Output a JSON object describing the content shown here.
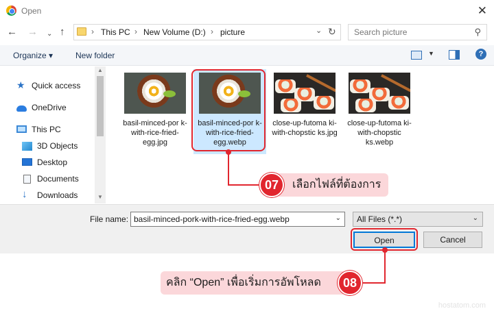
{
  "window": {
    "title": "Open"
  },
  "address": {
    "crumbs": [
      "This PC",
      "New Volume (D:)",
      "picture"
    ]
  },
  "search": {
    "placeholder": "Search picture"
  },
  "toolbar": {
    "organize": "Organize ▾",
    "new_folder": "New folder"
  },
  "sidebar": {
    "items": [
      {
        "label": "Quick access",
        "icon": "star-icon"
      },
      {
        "label": "OneDrive",
        "icon": "cloud-icon"
      },
      {
        "label": "This PC",
        "icon": "computer-icon"
      },
      {
        "label": "3D Objects",
        "icon": "cube-icon"
      },
      {
        "label": "Desktop",
        "icon": "desktop-icon"
      },
      {
        "label": "Documents",
        "icon": "document-icon"
      },
      {
        "label": "Downloads",
        "icon": "download-icon"
      }
    ]
  },
  "files": [
    {
      "name": "basil-minced-pork-with-rice-fried-egg.jpg",
      "display": "basil-minced-por k-with-rice-fried- egg.jpg",
      "selected": false
    },
    {
      "name": "basil-minced-pork-with-rice-fried-egg.webp",
      "display": "basil-minced-por k-with-rice-fried- egg.webp",
      "selected": true
    },
    {
      "name": "close-up-futomaki-with-chopsticks.jpg",
      "display": "close-up-futoma ki-with-chopstic ks.jpg",
      "selected": false
    },
    {
      "name": "close-up-futomaki-with-chopsticks.webp",
      "display": "close-up-futoma ki-with-chopstic ks.webp",
      "selected": false
    }
  ],
  "bottom": {
    "filename_label": "File name:",
    "filename_value": "basil-minced-pork-with-rice-fried-egg.webp",
    "filter": "All Files (*.*)",
    "open": "Open",
    "cancel": "Cancel"
  },
  "annotations": {
    "step7": {
      "number": "07",
      "text": "เลือกไฟล์ที่ต้องการ"
    },
    "step8": {
      "number": "08",
      "text": "คลิก “Open” เพื่อเริ่มการอัพโหลด"
    },
    "watermark": "hostatom.com"
  },
  "colors": {
    "accent": "#e1262e",
    "callout_bg": "#fbd7da",
    "selection": "#cce8ff"
  }
}
